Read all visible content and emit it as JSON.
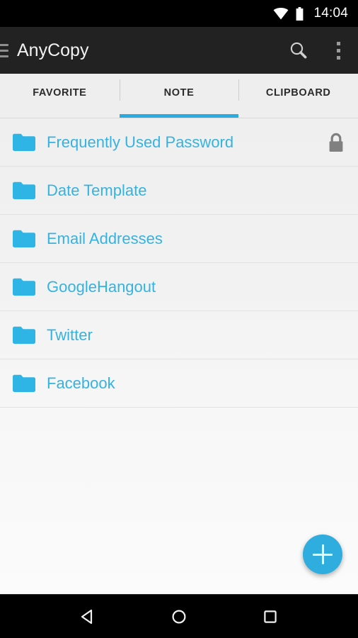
{
  "status_bar": {
    "time": "14:04",
    "wifi_icon": "wifi-icon",
    "battery_icon": "battery-icon"
  },
  "toolbar": {
    "title": "AnyCopy",
    "menu_icon": "hamburger-menu-icon",
    "search_icon": "search-icon",
    "overflow_icon": "overflow-menu-icon",
    "background_color": "#222222"
  },
  "tabs": {
    "active_index": 1,
    "indicator_color": "#29abe2",
    "items": [
      {
        "label": "FAVORITE"
      },
      {
        "label": "NOTE"
      },
      {
        "label": "CLIPBOARD"
      }
    ]
  },
  "list": {
    "accent_color": "#35b3e0",
    "rows": [
      {
        "label": "Frequently Used Password",
        "icon": "folder-icon",
        "locked": true
      },
      {
        "label": "Date Template",
        "icon": "folder-icon",
        "locked": false
      },
      {
        "label": "Email Addresses",
        "icon": "folder-icon",
        "locked": false
      },
      {
        "label": "GoogleHangout",
        "icon": "folder-icon",
        "locked": false
      },
      {
        "label": "Twitter",
        "icon": "folder-icon",
        "locked": false
      },
      {
        "label": "Facebook",
        "icon": "folder-icon",
        "locked": false
      }
    ]
  },
  "fab": {
    "icon": "plus-icon",
    "color": "#2fadde"
  },
  "navigation_bar": {
    "back_icon": "back-triangle-icon",
    "home_icon": "home-circle-icon",
    "recents_icon": "recents-square-icon"
  }
}
